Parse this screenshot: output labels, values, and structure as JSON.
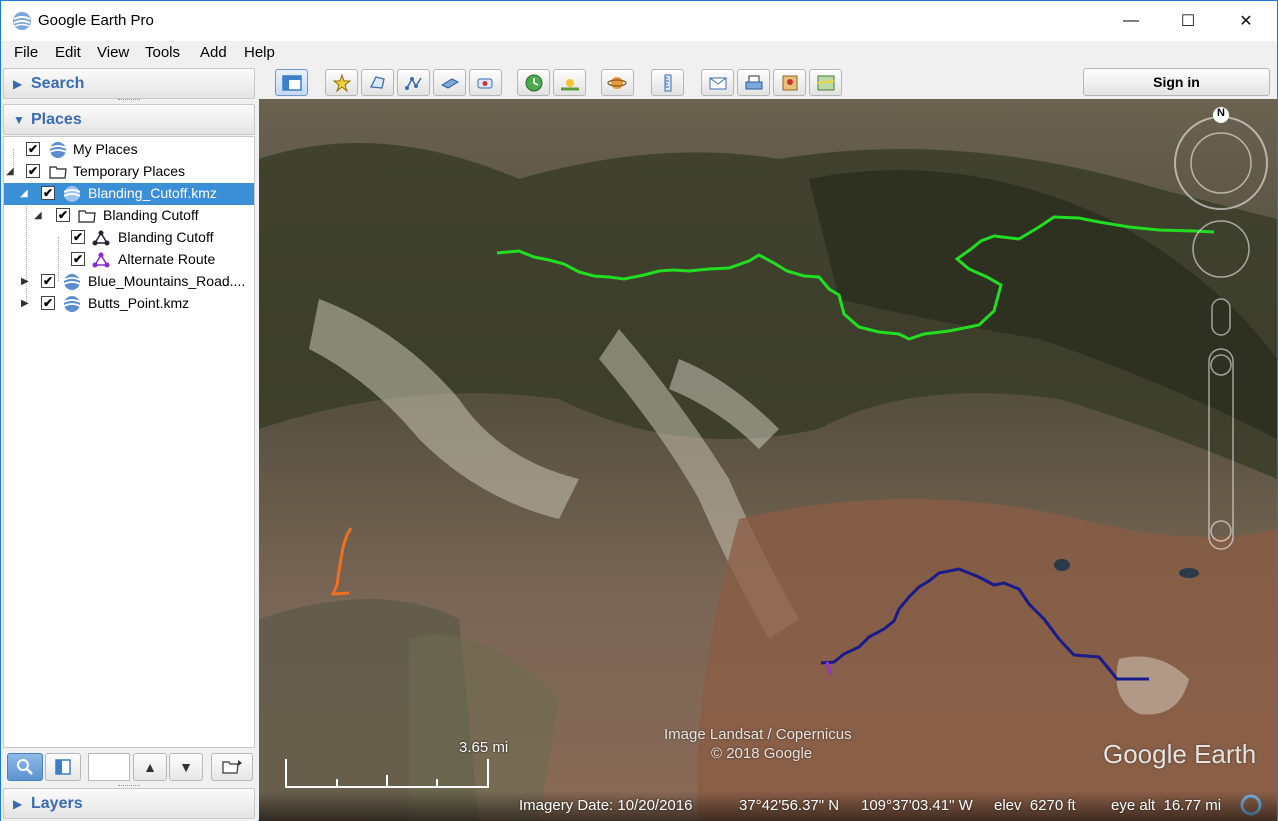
{
  "window": {
    "title": "Google Earth Pro",
    "min_glyph": "—",
    "max_glyph": "☐",
    "close_glyph": "✕"
  },
  "menu": [
    "File",
    "Edit",
    "View",
    "Tools",
    "Add",
    "Help"
  ],
  "sidebar": {
    "search_label": "Search",
    "places_label": "Places",
    "layers_label": "Layers",
    "tree": [
      {
        "label": "My Places",
        "checked": true,
        "icon": "globe-icon"
      },
      {
        "label": "Temporary Places",
        "checked": true,
        "icon": "folder-icon"
      },
      {
        "label": "Blanding_Cutoff.kmz",
        "checked": true,
        "icon": "globe-icon",
        "selected": true
      },
      {
        "label": "Blanding Cutoff",
        "checked": true,
        "icon": "folder-icon"
      },
      {
        "label": "Blanding Cutoff",
        "checked": true,
        "icon": "path-icon"
      },
      {
        "label": "Alternate Route",
        "checked": true,
        "icon": "path-icon"
      },
      {
        "label": "Blue_Mountains_Road....",
        "checked": true,
        "icon": "globe-icon"
      },
      {
        "label": "Butts_Point.kmz",
        "checked": true,
        "icon": "globe-icon"
      }
    ],
    "check_glyph": "✔",
    "up_glyph": "▲",
    "down_glyph": "▼"
  },
  "toolbar": {
    "buttons": [
      "sidebar-toggle",
      "add-placemark",
      "add-polygon",
      "add-path",
      "add-image-overlay",
      "record-tour",
      "historical-imagery",
      "sunlight",
      "switch-planet",
      "ruler",
      "email",
      "print",
      "save-image",
      "view-in-maps"
    ],
    "signin_label": "Sign in"
  },
  "map": {
    "compass_label": "N",
    "attribution_line1": "Image Landsat / Copernicus",
    "attribution_line2": "© 2018 Google",
    "logo": "Google Earth",
    "scale_label": "3.65 mi",
    "status": {
      "imagery_date": "Imagery Date: 10/20/2016",
      "lat": "37°42'56.37\" N",
      "lon": "109°37'03.41\" W",
      "elev": "elev  6270 ft",
      "eye_alt": "eye alt  16.77 mi"
    },
    "route_colors": {
      "blanding_cutoff": "#22dd22",
      "alternate": "#1a1a8a",
      "butts_point": "#f07020",
      "purple": "#9933cc"
    }
  }
}
